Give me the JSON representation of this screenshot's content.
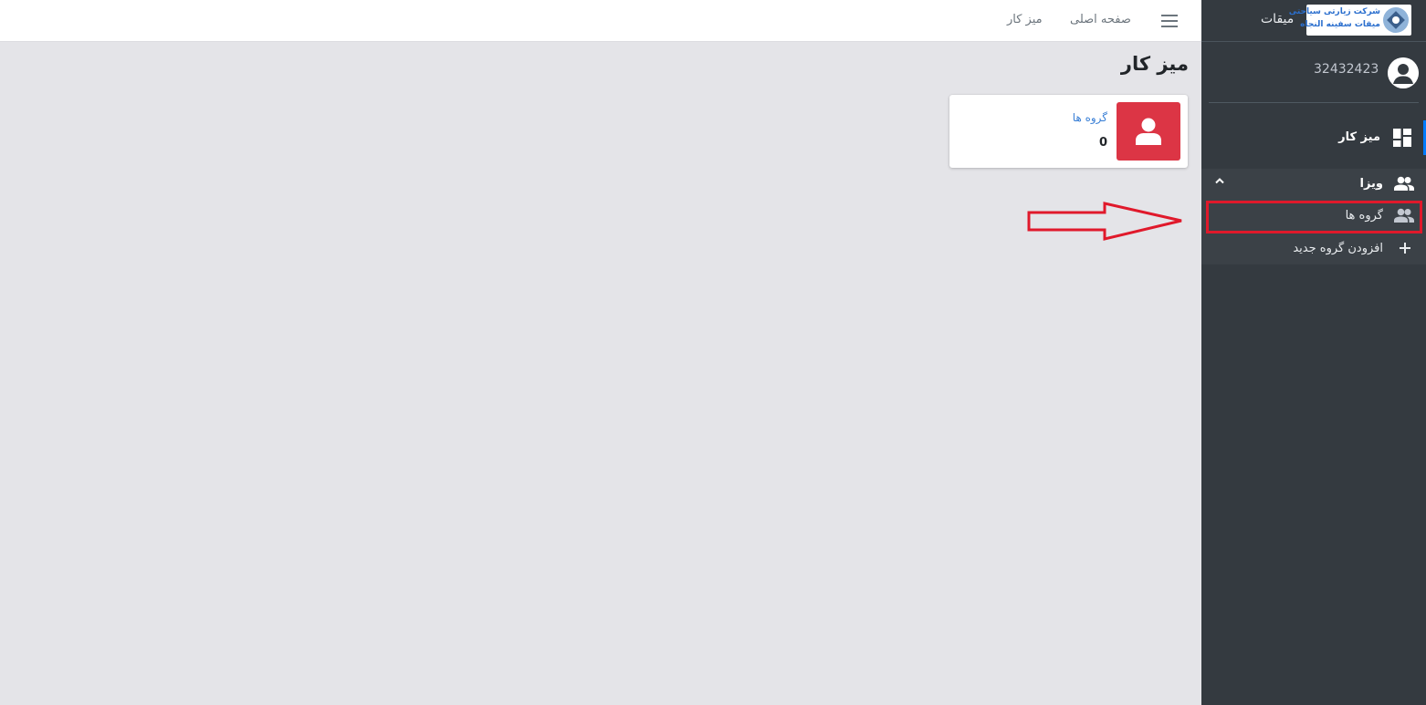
{
  "navbar": {
    "home_label": "صفحه اصلی",
    "dashboard_label": "میز کار"
  },
  "main": {
    "page_title": "میز کار",
    "info_box": {
      "label": "گروه ها",
      "value": "0",
      "icon": "user-icon",
      "color": "#dc3545"
    }
  },
  "sidebar": {
    "brand": {
      "name": "میقات",
      "logo_line1": "شرکت زیارتی سیاحتی",
      "logo_line2": "میقات سفینه النجاه"
    },
    "user": {
      "name": "32432423"
    },
    "items": {
      "dashboard": {
        "label": "میز کار",
        "icon": "dashboard-icon"
      },
      "visa": {
        "label": "ویزا",
        "icon": "users-icon"
      },
      "groups": {
        "label": "گروه ها",
        "icon": "users-icon"
      },
      "add_group": {
        "label": "افزودن گروه جدید",
        "icon": "plus-icon"
      }
    }
  },
  "colors": {
    "sidebar_bg": "#343a40",
    "accent": "#007bff",
    "danger": "#dc3545",
    "annotation": "#e0192b"
  }
}
